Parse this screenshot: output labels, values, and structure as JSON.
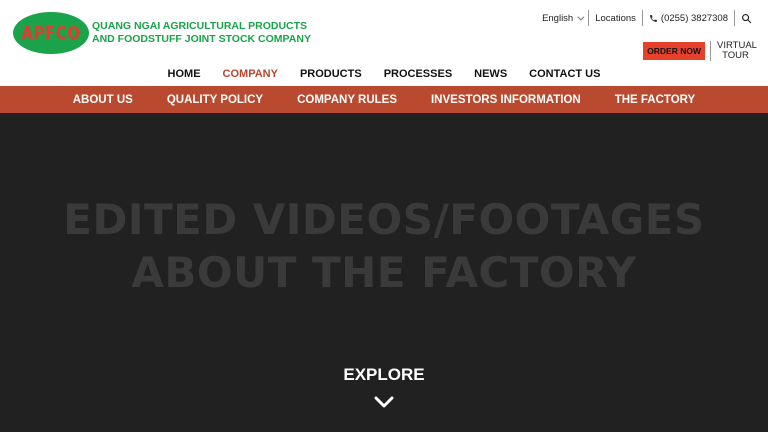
{
  "brand": {
    "logo_text": "APFCO",
    "name_line1": "QUANG NGAI AGRICULTURAL PRODUCTS",
    "name_line2": "AND FOODSTUFF JOINT STOCK COMPANY",
    "green": "#1aa34a",
    "red": "#e53a2f"
  },
  "utility": {
    "language": "English",
    "locations": "Locations",
    "phone": "(0255) 3827308",
    "search_icon": "search-icon"
  },
  "order_now": "ORDER NOW",
  "virtual_tour_line1": "VIRTUAL",
  "virtual_tour_line2": "TOUR",
  "main_nav": [
    {
      "label": "HOME"
    },
    {
      "label": "COMPANY"
    },
    {
      "label": "PRODUCTS"
    },
    {
      "label": "PROCESSES"
    },
    {
      "label": "NEWS"
    },
    {
      "label": "CONTACT US"
    }
  ],
  "sub_nav": [
    {
      "label": "ABOUT US"
    },
    {
      "label": "QUALITY POLICY"
    },
    {
      "label": "COMPANY RULES"
    },
    {
      "label": "INVESTORS INFORMATION"
    },
    {
      "label": "THE FACTORY"
    }
  ],
  "hero": {
    "title_line1": "EDITED VIDEOS/FOOTAGES",
    "title_line2": "ABOUT THE FACTORY",
    "explore": "EXPLORE"
  },
  "colors": {
    "subnav_bg": "#b94a30",
    "active_nav": "#b5472f",
    "hero_bg": "#212121"
  }
}
